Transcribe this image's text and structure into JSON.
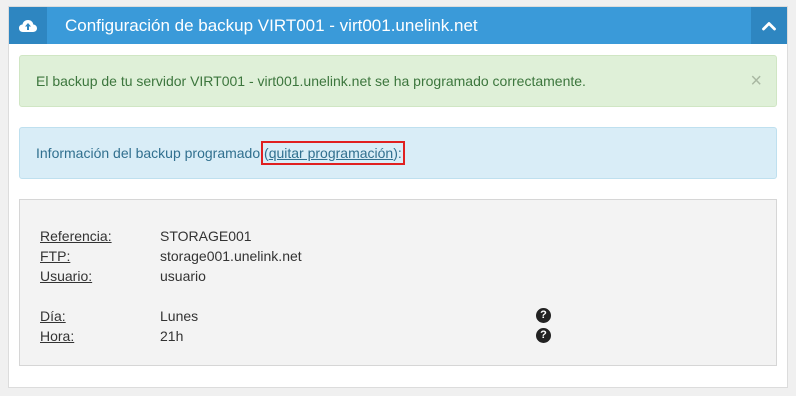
{
  "panel": {
    "title": "Configuración de backup VIRT001 - virt001.unelink.net",
    "header_icon": "cloud-upload-icon",
    "toggle_icon": "chevron-up-icon"
  },
  "success_alert": {
    "message": "El backup de tu servidor VIRT001 - virt001.unelink.net se ha programado correctamente.",
    "close": "×"
  },
  "info_alert": {
    "prefix": "Información del backup programado",
    "link_open": "(",
    "link_label": "quitar programación",
    "link_close": "):"
  },
  "details": {
    "referencia": {
      "label": "Referencia:",
      "value": "STORAGE001"
    },
    "ftp": {
      "label": "FTP:",
      "value": "storage001.unelink.net"
    },
    "usuario": {
      "label": "Usuario:",
      "value": "usuario"
    },
    "dia": {
      "label": "Día:",
      "value": "Lunes"
    },
    "hora": {
      "label": "Hora:",
      "value": "21h"
    },
    "help_symbol": "?"
  },
  "colors": {
    "header": "#3a9ad9",
    "success_bg": "#dff0d8",
    "info_bg": "#d9edf7",
    "highlight": "#e02020"
  }
}
